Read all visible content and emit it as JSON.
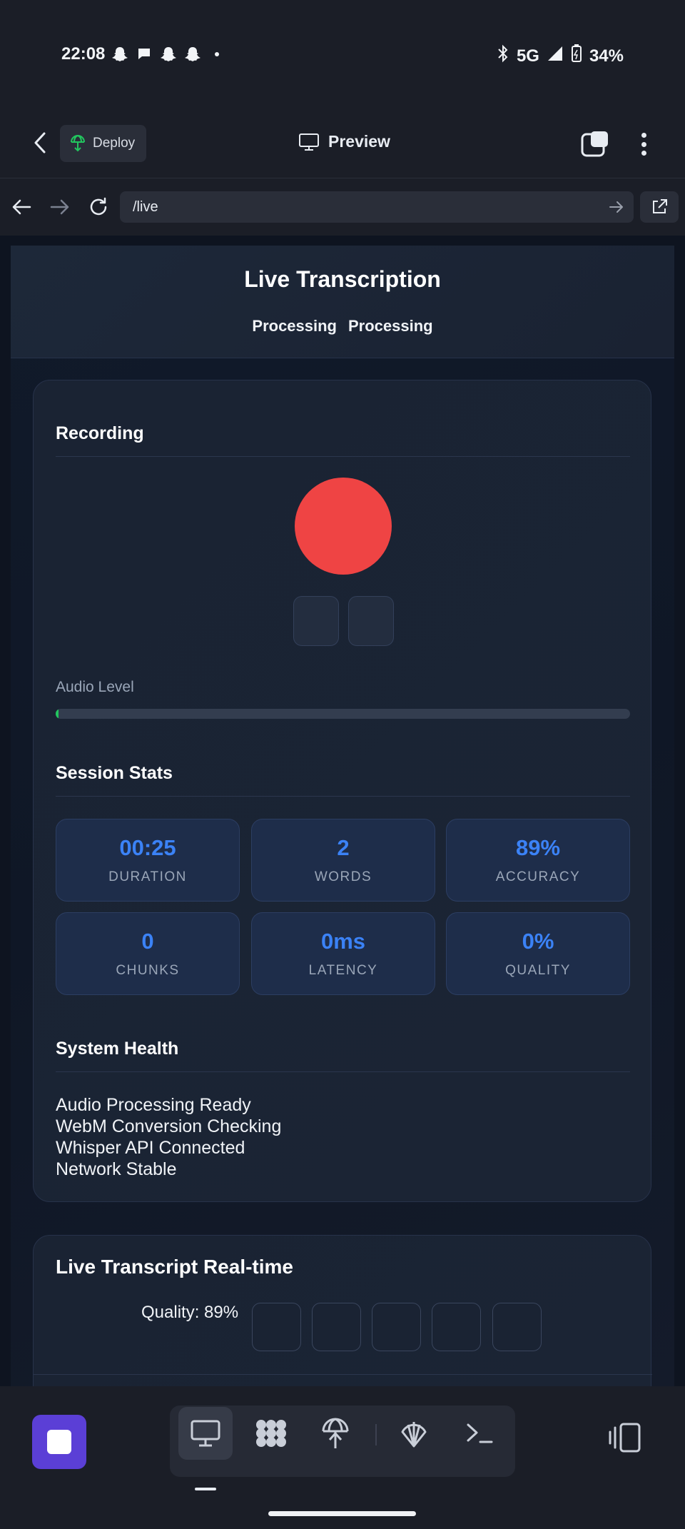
{
  "status_bar": {
    "time": "22:08",
    "network": "5G",
    "battery": "34%",
    "icons": [
      "snapchat-icon",
      "chat-icon",
      "snapchat-icon",
      "snapchat-icon",
      "dot-icon",
      "bluetooth-icon",
      "signal-icon",
      "battery-icon"
    ]
  },
  "app_bar": {
    "deploy_label": "Deploy",
    "title": "Preview"
  },
  "url_bar": {
    "url": "/live"
  },
  "page": {
    "title": "Live Transcription",
    "status": [
      "Processing",
      "Processing"
    ],
    "recording": {
      "title": "Recording",
      "audio_level_label": "Audio Level",
      "audio_level": 0.005
    },
    "session_stats": {
      "title": "Session Stats",
      "stats": [
        {
          "value": "00:25",
          "label": "DURATION"
        },
        {
          "value": "2",
          "label": "WORDS"
        },
        {
          "value": "89%",
          "label": "ACCURACY"
        },
        {
          "value": "0",
          "label": "CHUNKS"
        },
        {
          "value": "0ms",
          "label": "LATENCY"
        },
        {
          "value": "0%",
          "label": "QUALITY"
        }
      ]
    },
    "system_health": {
      "title": "System Health",
      "items": [
        "Audio Processing Ready",
        "WebM Conversion Checking",
        "Whisper API Connected",
        "Network Stable"
      ]
    },
    "transcript": {
      "title": "Live Transcript Real-time",
      "quality": "Quality: 89%"
    }
  },
  "colors": {
    "accent": "#3b82f6",
    "record": "#ef4444",
    "stop": "#5b3fd6"
  }
}
